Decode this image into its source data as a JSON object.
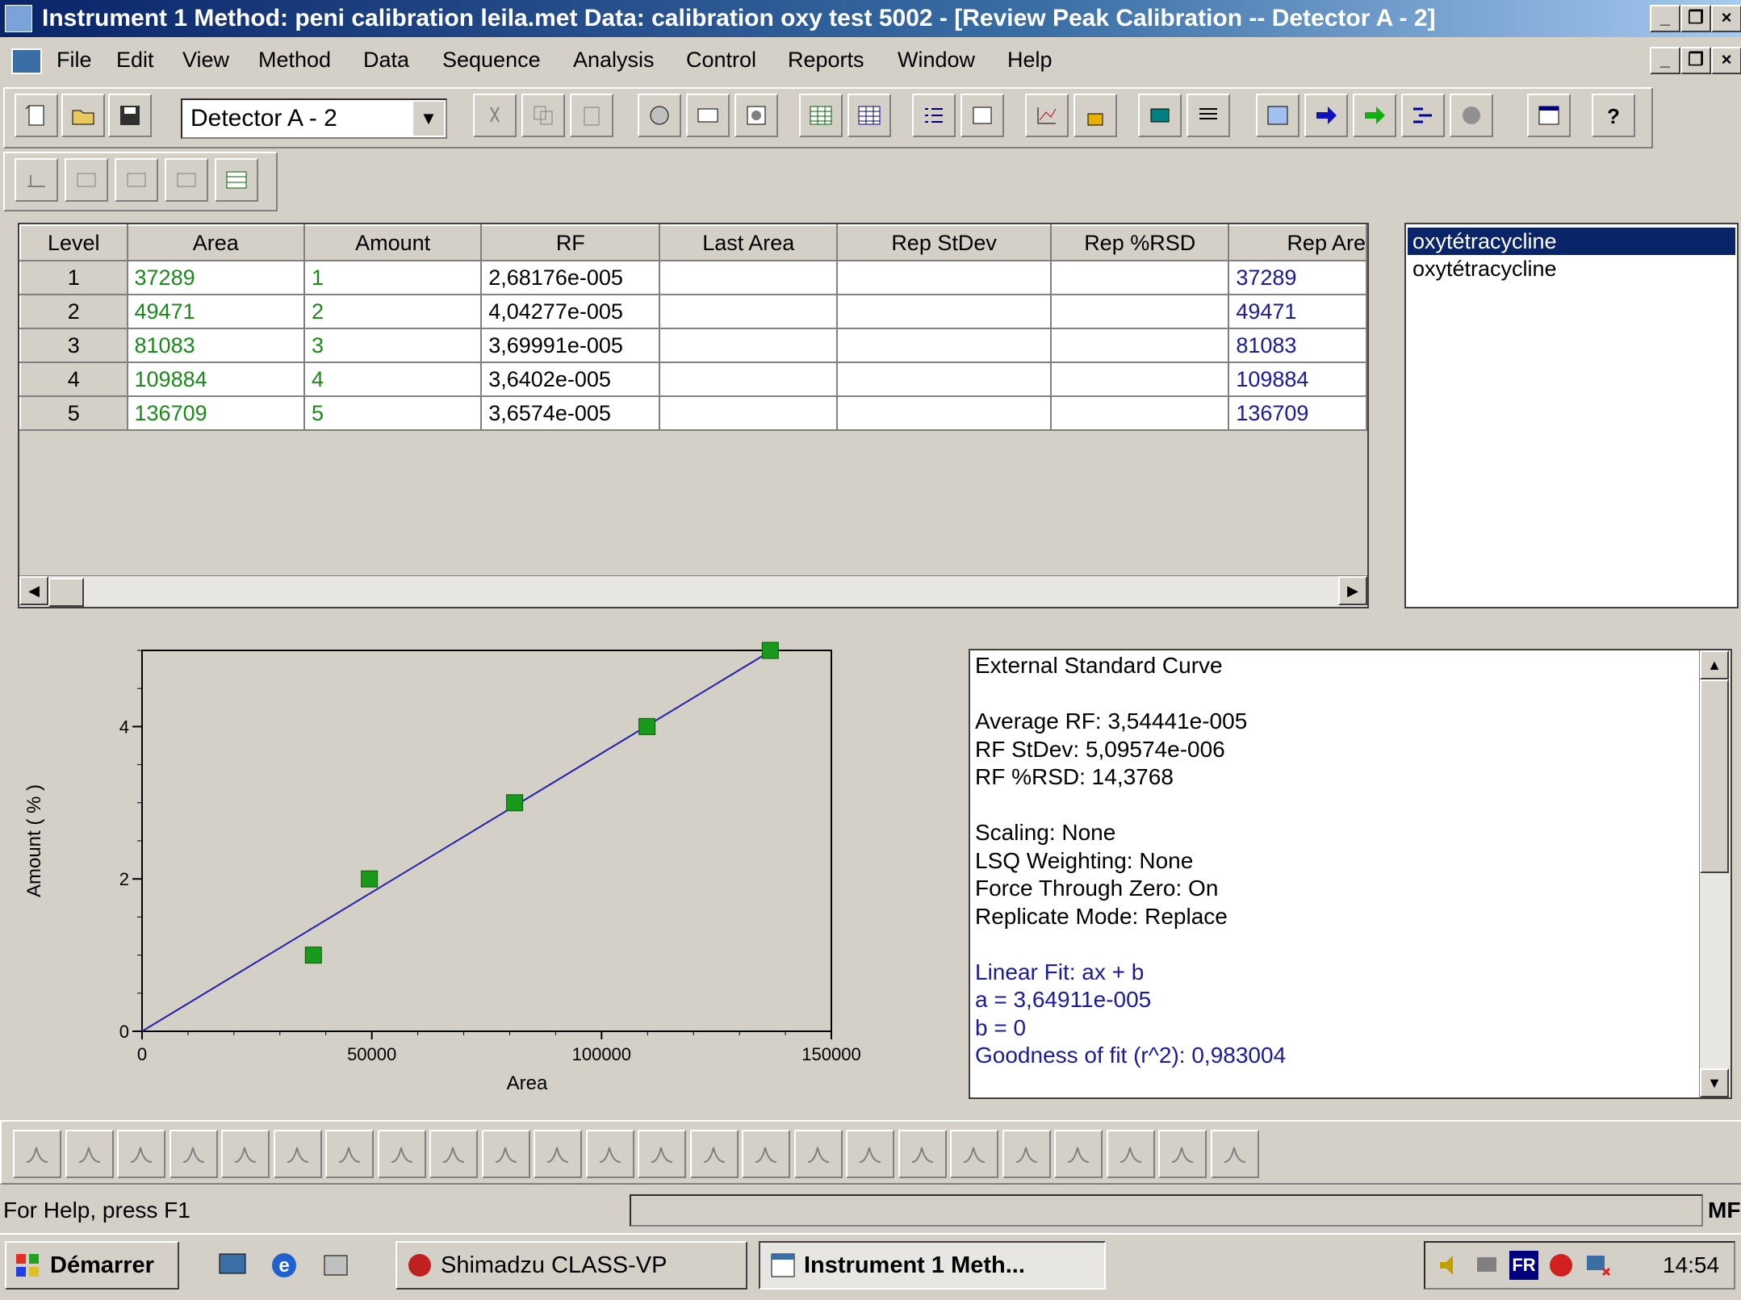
{
  "window": {
    "title": "Instrument 1   Method: peni calibration leila.met   Data: calibration oxy test 5002 - [Review Peak Calibration -- Detector A - 2]",
    "minimize": "_",
    "restore": "❐",
    "close": "×"
  },
  "menu": {
    "items": [
      "File",
      "Edit",
      "View",
      "Method",
      "Data",
      "Sequence",
      "Analysis",
      "Control",
      "Reports",
      "Window",
      "Help"
    ]
  },
  "toolbar": {
    "detector_value": "Detector A - 2"
  },
  "calibration_table": {
    "columns": [
      "Level",
      "Area",
      "Amount",
      "RF",
      "Last Area",
      "Rep StDev",
      "Rep %RSD",
      "Rep Are"
    ],
    "rows": [
      {
        "level": "1",
        "area": "37289",
        "amount": "1",
        "rf": "2,68176e-005",
        "last_area": "",
        "rep_stdev": "",
        "rep_rsd": "",
        "rep_area": "37289"
      },
      {
        "level": "2",
        "area": "49471",
        "amount": "2",
        "rf": "4,04277e-005",
        "last_area": "",
        "rep_stdev": "",
        "rep_rsd": "",
        "rep_area": "49471"
      },
      {
        "level": "3",
        "area": "81083",
        "amount": "3",
        "rf": "3,69991e-005",
        "last_area": "",
        "rep_stdev": "",
        "rep_rsd": "",
        "rep_area": "81083"
      },
      {
        "level": "4",
        "area": "109884",
        "amount": "4",
        "rf": "3,6402e-005",
        "last_area": "",
        "rep_stdev": "",
        "rep_rsd": "",
        "rep_area": "109884"
      },
      {
        "level": "5",
        "area": "136709",
        "amount": "5",
        "rf": "3,6574e-005",
        "last_area": "",
        "rep_stdev": "",
        "rep_rsd": "",
        "rep_area": "136709"
      }
    ]
  },
  "compound_list": {
    "items": [
      "oxytétracycline",
      "oxytétracycline"
    ],
    "selected_index": 0
  },
  "chart_data": {
    "type": "scatter",
    "xlabel": "Area",
    "ylabel": "Amount ( % )",
    "xlim": [
      0,
      150000
    ],
    "ylim": [
      0,
      5
    ],
    "x_ticks": [
      "0",
      "50000",
      "100000",
      "150000"
    ],
    "y_ticks": [
      "0",
      "2",
      "4"
    ],
    "points": [
      {
        "x": 37289,
        "y": 1
      },
      {
        "x": 49471,
        "y": 2
      },
      {
        "x": 81083,
        "y": 3
      },
      {
        "x": 109884,
        "y": 4
      },
      {
        "x": 136709,
        "y": 5
      }
    ],
    "fit_line": {
      "slope": 3.64911e-05,
      "intercept": 0
    },
    "point_color": "#1a9a1a",
    "line_color": "#2020b0",
    "grid": false
  },
  "info_panel": {
    "lines": [
      "External Standard Curve",
      "",
      "Average RF: 3,54441e-005",
      "RF StDev: 5,09574e-006",
      "RF %RSD: 14,3768",
      "",
      "Scaling: None",
      "LSQ Weighting: None",
      "Force Through Zero: On",
      "Replicate Mode: Replace",
      "",
      "Linear Fit:   ax + b",
      "   a = 3,64911e-005",
      "   b = 0",
      "Goodness of fit (r^2): 0,983004"
    ]
  },
  "status_bar": {
    "help_text": "For Help, press F1",
    "right_text": "MF"
  },
  "taskbar": {
    "start_label": "Démarrer",
    "tasks": [
      "Shimadzu CLASS-VP",
      "Instrument 1     Meth..."
    ],
    "clock": "14:54",
    "language": "FR"
  },
  "colors": {
    "titlebar_start": "#0a246a",
    "selection": "#0a246a",
    "green_values": "#1a8a1a",
    "blue_values": "#1a1aa0",
    "chart_background": "#d4d0c8"
  }
}
